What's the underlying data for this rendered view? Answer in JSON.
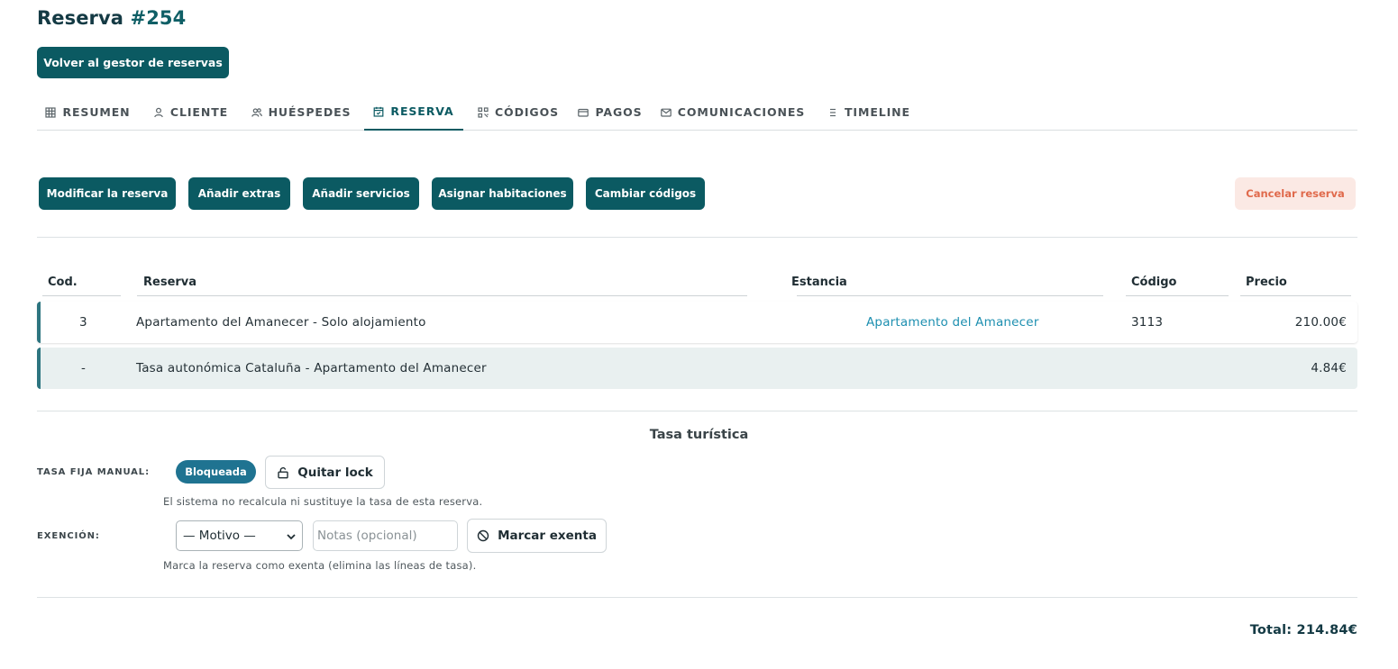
{
  "header": {
    "title": "Reserva",
    "number": "#254"
  },
  "back_button": "Volver al gestor de reservas",
  "tabs": [
    {
      "label": "RESUMEN",
      "icon": "grid-icon"
    },
    {
      "label": "CLIENTE",
      "icon": "user-icon"
    },
    {
      "label": "HUÉSPEDES",
      "icon": "users-icon"
    },
    {
      "label": "RESERVA",
      "icon": "calendar-icon",
      "active": true
    },
    {
      "label": "CÓDIGOS",
      "icon": "qr-icon"
    },
    {
      "label": "PAGOS",
      "icon": "card-icon"
    },
    {
      "label": "COMUNICACIONES",
      "icon": "mail-icon"
    },
    {
      "label": "TIMELINE",
      "icon": "list-icon"
    }
  ],
  "actions": {
    "modify": "Modificar la reserva",
    "extras": "Añadir extras",
    "services": "Añadir servicios",
    "rooms": "Asignar habitaciones",
    "codes": "Cambiar códigos",
    "cancel": "Cancelar reserva"
  },
  "table": {
    "headers": {
      "cod": "Cod.",
      "reserva": "Reserva",
      "estancia": "Estancia",
      "codigo": "Código",
      "precio": "Precio"
    },
    "rows": [
      {
        "cod": "3",
        "reserva": "Apartamento del Amanecer - Solo alojamiento",
        "estancia": "Apartamento del Amanecer",
        "codigo": "3113",
        "precio": "210.00€"
      },
      {
        "cod": "-",
        "reserva": "Tasa autonómica Cataluña - Apartamento del Amanecer",
        "estancia": "",
        "codigo": "",
        "precio": "4.84€"
      }
    ]
  },
  "tax": {
    "title": "Tasa turística",
    "manual_label": "TASA FIJA MANUAL:",
    "status_badge": "Bloqueada",
    "unlock_button": "Quitar lock",
    "manual_hint": "El sistema no recalcula ni sustituye la tasa de esta reserva.",
    "exemption_label": "EXENCIÓN:",
    "reason_select": "— Motivo —",
    "notes_placeholder": "Notas (opcional)",
    "exempt_button": "Marcar exenta",
    "exemption_hint": "Marca la reserva como exenta (elimina las líneas de tasa)."
  },
  "total": "Total: 214.84€",
  "colors": {
    "primary": "#0b5a62",
    "badge": "#1f7391",
    "link": "#1d8fb0",
    "cancel_text": "#e06a4c",
    "cancel_bg": "#fbe9e4"
  }
}
